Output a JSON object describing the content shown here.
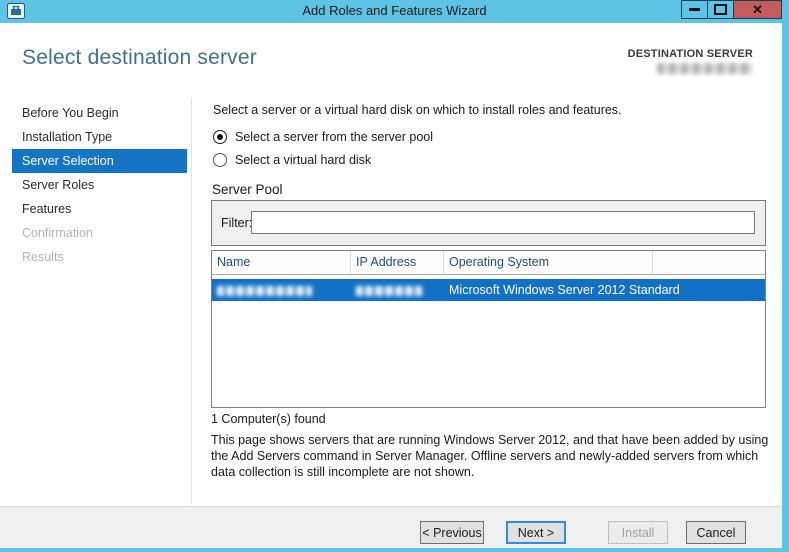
{
  "window": {
    "title": "Add Roles and Features Wizard",
    "close_glyph": "✕"
  },
  "header": {
    "title": "Select destination server",
    "destination_label": "DESTINATION SERVER",
    "destination_value_redacted": true
  },
  "sidebar": {
    "items": [
      {
        "label": "Before You Begin",
        "state": "enabled"
      },
      {
        "label": "Installation Type",
        "state": "enabled"
      },
      {
        "label": "Server Selection",
        "state": "selected"
      },
      {
        "label": "Server Roles",
        "state": "enabled"
      },
      {
        "label": "Features",
        "state": "enabled"
      },
      {
        "label": "Confirmation",
        "state": "disabled"
      },
      {
        "label": "Results",
        "state": "disabled"
      }
    ]
  },
  "content": {
    "instruction": "Select a server or a virtual hard disk on which to install roles and features.",
    "radios": [
      {
        "label": "Select a server from the server pool",
        "selected": true
      },
      {
        "label": "Select a virtual hard disk",
        "selected": false
      }
    ],
    "server_pool": {
      "title": "Server Pool",
      "filter_label": "Filter:",
      "filter_value": "",
      "table": {
        "columns": [
          "Name",
          "IP Address",
          "Operating System"
        ],
        "rows": [
          {
            "name_redacted": true,
            "ip_redacted": true,
            "os": "Microsoft Windows Server 2012 Standard",
            "selected": true
          }
        ]
      },
      "count_text": "1 Computer(s) found"
    },
    "description": "This page shows servers that are running Windows Server 2012, and that have been added by using the Add Servers command in Server Manager. Offline servers and newly-added servers from which data collection is still incomplete are not shown."
  },
  "footer": {
    "buttons": [
      {
        "label": "< Previous",
        "state": "enabled"
      },
      {
        "label": "Next >",
        "state": "focused"
      },
      {
        "label": "Install",
        "state": "disabled"
      },
      {
        "label": "Cancel",
        "state": "enabled"
      }
    ]
  },
  "colors": {
    "titlebar": "#5fc3e5",
    "selection_blue": "#1271c6",
    "close_button": "#c35d5d",
    "header_title": "#41708c",
    "table_header_text": "#1f4e79",
    "footer_bg": "#f0f0f0"
  }
}
